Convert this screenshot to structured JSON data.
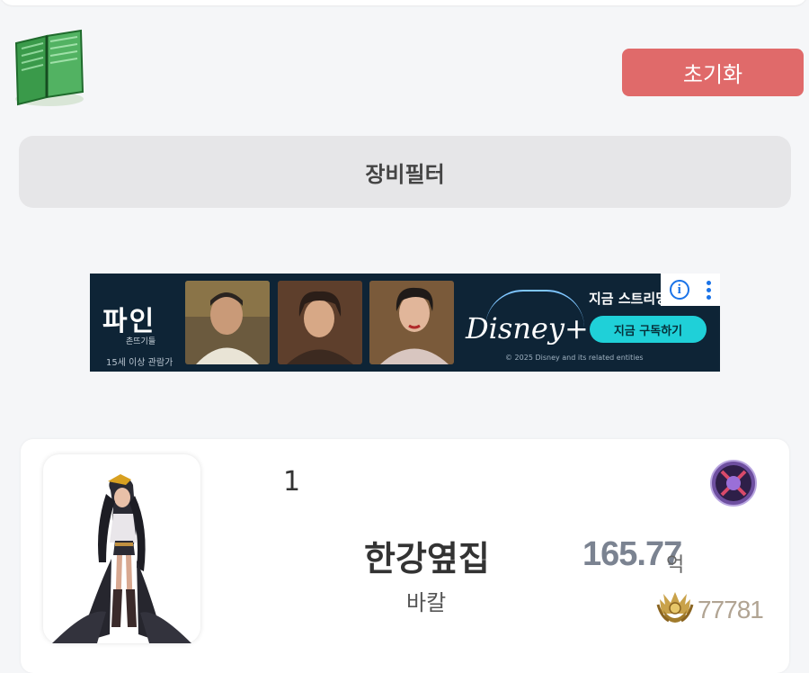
{
  "toolbar": {
    "reset_label": "초기화"
  },
  "filter": {
    "label": "장비필터"
  },
  "ad": {
    "title": "파인",
    "subtitle": "촌뜨기들",
    "age_rating": "15세 이상 관람가",
    "brand": "Disney+",
    "headline": "지금 스트리밍 중",
    "cta": "지금 구독하기",
    "copyright": "© 2025 Disney and its related entities",
    "info_icon": "info-icon",
    "menu_icon": "kebab-icon",
    "accent": "#1fd0d8"
  },
  "ranking": {
    "rank": "1",
    "name": "한강옆집",
    "class": "바칼",
    "power": "165.77",
    "power_unit": "억",
    "fame": "77781",
    "accent": "#e06a6a"
  }
}
